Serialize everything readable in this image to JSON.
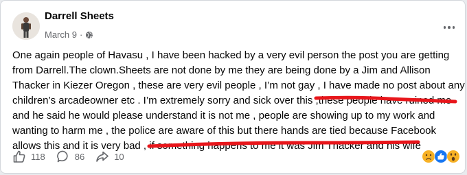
{
  "post": {
    "author": "Darrell Sheets",
    "date": "March 9",
    "separator": "·",
    "privacy_icon": "globe-icon",
    "body_lines": [
      "One again people of Havasu , I have been hacked by a very evil person the post you are getting",
      "from Darrell.The clown.Sheets are not done by me they are being done by a Jim and Allison",
      "Thacker in Kiezer Oregon , these are very evil people , I’m not gay , I have made no post about any",
      "children’s arcadeowner etc . I’m extremely sorry and sick over this ,these people have ruined me",
      "and he said he would please understand it is not me , people are showing up to my work and",
      "wanting to harm me , the police are aware of this but there hands are tied because Facebook",
      "allows this and it is very bad , if something happens to me it was Jim Thacker and his wife"
    ]
  },
  "actions": {
    "likes": "118",
    "comments": "86",
    "shares": "10"
  },
  "reactions": [
    "sad-emoji",
    "like-icon",
    "wow-emoji"
  ],
  "colors": {
    "annotation_red": "#e8161b",
    "facebook_blue": "#1877f2"
  }
}
